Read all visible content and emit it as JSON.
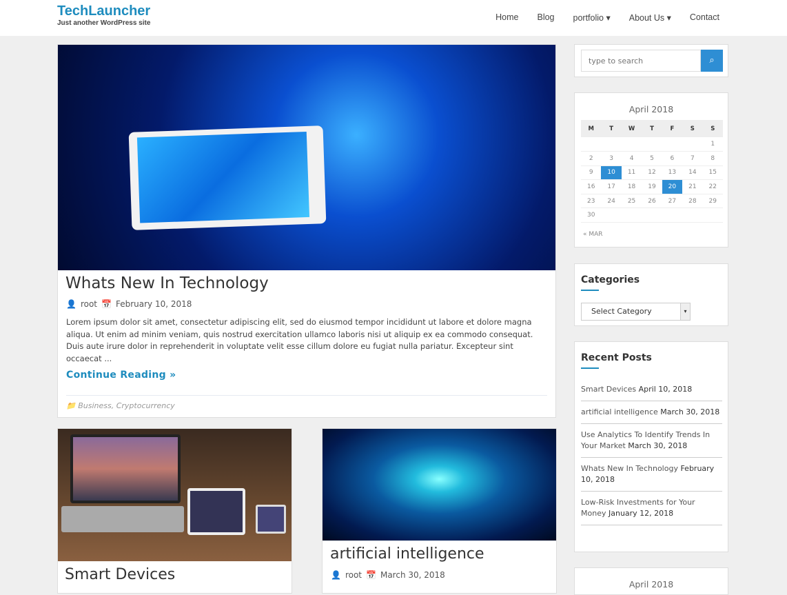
{
  "site": {
    "title": "TechLauncher",
    "tagline": "Just another WordPress site"
  },
  "nav": [
    {
      "label": "Home"
    },
    {
      "label": "Blog"
    },
    {
      "label": "portfolio ▾"
    },
    {
      "label": "About Us ▾"
    },
    {
      "label": "Contact"
    }
  ],
  "featured": {
    "title": "Whats New In Technology",
    "author": "root",
    "date": "February 10, 2018",
    "excerpt": "Lorem ipsum dolor sit amet, consectetur adipiscing elit, sed do eiusmod tempor incididunt ut labore et dolore magna aliqua. Ut enim ad minim veniam, quis nostrud exercitation ullamco laboris nisi ut aliquip ex ea commodo consequat. Duis aute irure dolor in reprehenderit in voluptate velit esse cillum dolore eu fugiat nulla pariatur. Excepteur sint occaecat ...",
    "more": "Continue Reading »",
    "cat1": "Business",
    "sep": ",",
    "cat2": "Cryptocurrency"
  },
  "posts": [
    {
      "title": "Smart Devices"
    },
    {
      "title": "artificial intelligence",
      "author": "root",
      "date": "March 30, 2018"
    }
  ],
  "search": {
    "placeholder": "type to search"
  },
  "calendar": {
    "caption": "April 2018",
    "days": [
      "M",
      "T",
      "W",
      "T",
      "F",
      "S",
      "S"
    ],
    "weeks": [
      [
        "",
        "",
        "",
        "",
        "",
        "",
        "1"
      ],
      [
        "2",
        "3",
        "4",
        "5",
        "6",
        "7",
        "8"
      ],
      [
        "9",
        "10",
        "11",
        "12",
        "13",
        "14",
        "15"
      ],
      [
        "16",
        "17",
        "18",
        "19",
        "20",
        "21",
        "22"
      ],
      [
        "23",
        "24",
        "25",
        "26",
        "27",
        "28",
        "29"
      ],
      [
        "30",
        "",
        "",
        "",
        "",
        "",
        ""
      ]
    ],
    "highlighted": [
      "10",
      "20"
    ],
    "prev": "« MAR",
    "accent": "#2e8ed4"
  },
  "categories": {
    "title": "Categories",
    "select": "Select Category"
  },
  "recent": {
    "title": "Recent Posts",
    "items": [
      {
        "t": "Smart Devices",
        "d": "April 10, 2018"
      },
      {
        "t": "artificial intelligence",
        "d": "March 30, 2018"
      },
      {
        "t": "Use Analytics To Identify Trends In Your Market",
        "d": "March 30, 2018"
      },
      {
        "t": "Whats New In Technology",
        "d": "February 10, 2018"
      },
      {
        "t": "Low-Risk Investments for Your Money",
        "d": "January 12, 2018"
      }
    ]
  },
  "calendar2": {
    "caption": "April 2018"
  }
}
